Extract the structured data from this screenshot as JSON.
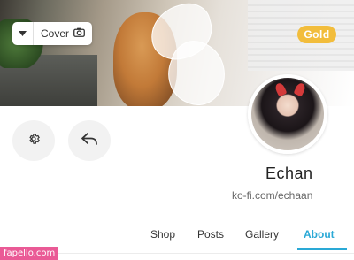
{
  "cover": {
    "button_label": "Cover",
    "caret_icon": "chevron-down-icon",
    "camera_icon": "camera-icon"
  },
  "badge": {
    "label": "Gold",
    "color": "#f2bd3c"
  },
  "profile": {
    "name": "Echan",
    "url": "ko-fi.com/echaan"
  },
  "actions": {
    "settings_icon": "gear-icon",
    "share_icon": "share-arrow-icon"
  },
  "tabs": [
    {
      "label": "Shop"
    },
    {
      "label": "Posts"
    },
    {
      "label": "Gallery"
    },
    {
      "label": "About",
      "active": true
    }
  ],
  "accent_color": "#2aa9d6",
  "watermark": {
    "text": "fapello.com",
    "color": "#ea5a96"
  }
}
